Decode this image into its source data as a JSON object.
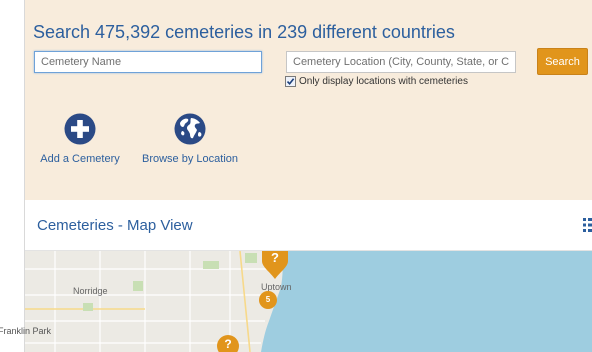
{
  "search": {
    "headline": "Search 475,392 cemeteries in 239 different countries",
    "name_placeholder": "Cemetery Name",
    "location_placeholder": "Cemetery Location (City, County, State, or C",
    "search_button": "Search",
    "only_locations_label": "Only display locations with cemeteries",
    "only_locations_checked": true
  },
  "quick_links": [
    {
      "label": "Add a Cemetery",
      "icon": "plus-circle-icon"
    },
    {
      "label": "Browse by Location",
      "icon": "globe-icon"
    }
  ],
  "map_section": {
    "title": "Cemeteries - Map View",
    "view_icon": "list-view-icon"
  },
  "map": {
    "places": [
      "Norridge",
      "Uptown",
      "Franklin Park"
    ],
    "clusters": [
      "5"
    ],
    "markers": [
      "?",
      "?"
    ]
  },
  "colors": {
    "panel_background": "#f8ecdc",
    "heading_blue": "#2c5f9e",
    "accent_orange": "#e1951c",
    "water": "#9ecde0",
    "land": "#eceae4"
  }
}
